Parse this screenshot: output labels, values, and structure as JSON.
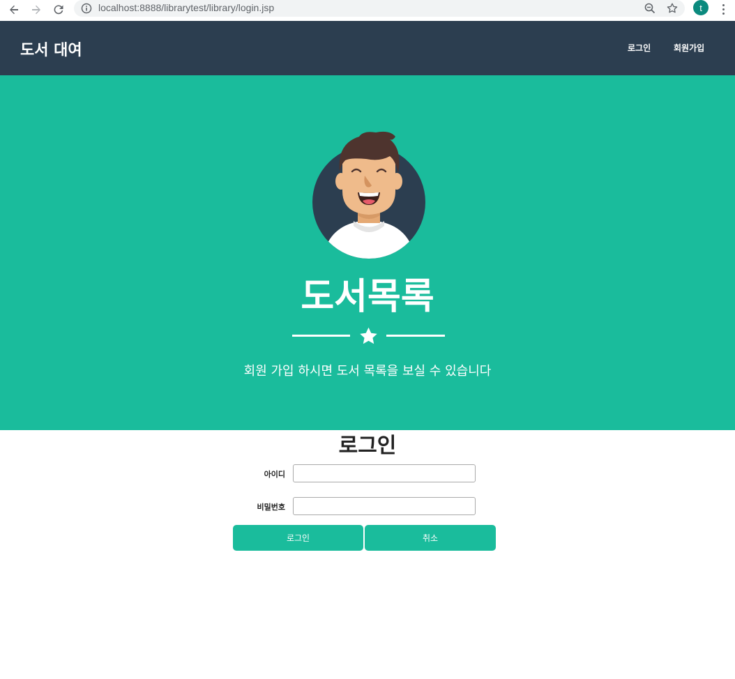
{
  "browser": {
    "url": "localhost:8888/librarytest/library/login.jsp",
    "profile_initial": "t",
    "icons": [
      "back-icon",
      "forward-icon",
      "reload-icon",
      "info-icon",
      "zoom-out-icon",
      "bookmark-star-icon",
      "more-menu-icon"
    ]
  },
  "navbar": {
    "brand": "도서 대여",
    "links": [
      {
        "label": "로그인"
      },
      {
        "label": "회원가입"
      }
    ],
    "background": "#2c3e50"
  },
  "hero": {
    "title": "도서목록",
    "subtitle": "회원 가입 하시면 도서 목록을 보실 수 있습니다",
    "background": "#1abc9c"
  },
  "login": {
    "title": "로그인",
    "id_label": "아이디",
    "id_value": "",
    "password_label": "비밀번호",
    "password_value": "",
    "login_button": "로그인",
    "cancel_button": "취소"
  },
  "colors": {
    "accent": "#1abc9c",
    "navbar": "#2c3e50"
  }
}
